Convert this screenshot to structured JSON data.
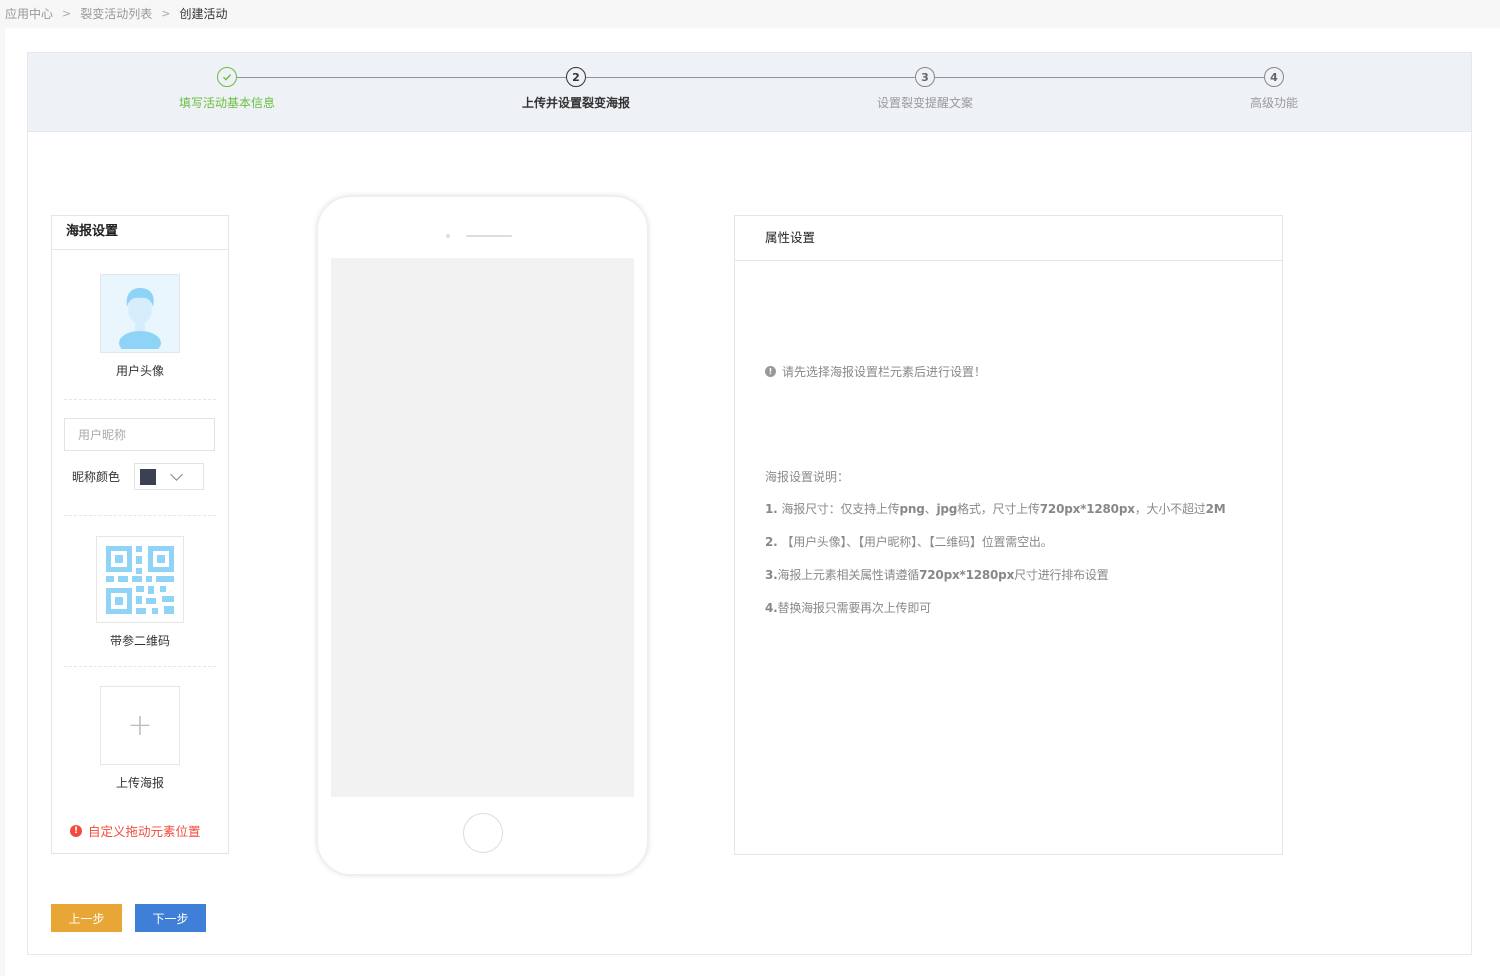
{
  "breadcrumb": {
    "items": [
      "应用中心",
      "裂变活动列表",
      "创建活动"
    ],
    "separator": ">"
  },
  "steps": [
    {
      "number": "1",
      "label": "填写活动基本信息",
      "state": "done"
    },
    {
      "number": "2",
      "label": "上传并设置裂变海报",
      "state": "active"
    },
    {
      "number": "3",
      "label": "设置裂变提醒文案",
      "state": "pending"
    },
    {
      "number": "4",
      "label": "高级功能",
      "state": "pending"
    }
  ],
  "poster_panel": {
    "title": "海报设置",
    "avatar_label": "用户头像",
    "nickname_placeholder": "用户昵称",
    "nickname_color_label": "昵称颜色",
    "nickname_color": "#3a4150",
    "qrcode_label": "带参二维码",
    "upload_label": "上传海报",
    "upload_icon": "+",
    "warning": "自定义拖动元素位置"
  },
  "attr_panel": {
    "title": "属性设置",
    "hint": "请先选择海报设置栏元素后进行设置！",
    "notes_title": "海报设置说明：",
    "notes": [
      {
        "a": "1. ",
        "b": "海报尺寸：仅支持上传",
        "c": "png",
        "d": "、",
        "e": "jpg",
        "f": "格式，尺寸上传",
        "g": "720px*1280px",
        "h": "，大小不超过",
        "i": "2M"
      },
      {
        "a": "2. ",
        "b": "【用户头像】、【用户昵称】、【二维码】位置需空出。"
      },
      {
        "a": "3.",
        "b": "海报上元素相关属性请遵循",
        "c": "720px*1280px",
        "d": "尺寸进行排布设置"
      },
      {
        "a": "4.",
        "b": "替换海报只需要再次上传即可"
      }
    ]
  },
  "buttons": {
    "prev": "上一步",
    "next": "下一步"
  },
  "colors": {
    "step_done": "#6abf40",
    "warning": "#f04b3c",
    "prev_button": "#e8a637",
    "next_button": "#3f7fd7"
  }
}
